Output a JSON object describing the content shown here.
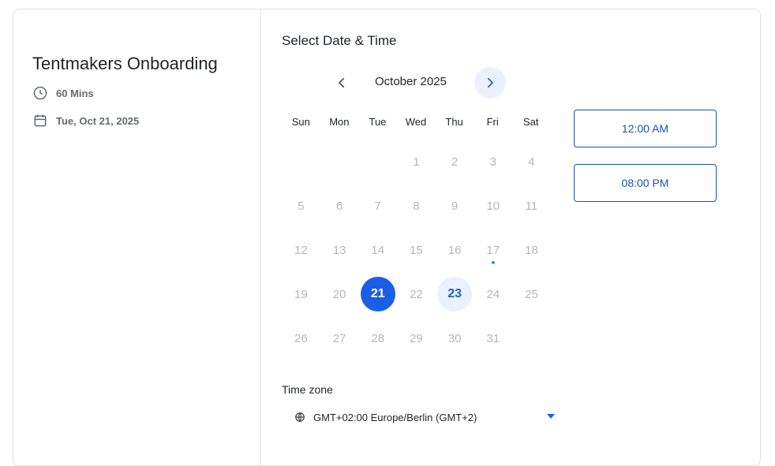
{
  "event": {
    "title": "Tentmakers Onboarding",
    "duration": "60 Mins",
    "date": "Tue, Oct 21, 2025"
  },
  "picker": {
    "heading": "Select Date & Time",
    "month_label": "October 2025",
    "weekdays": [
      "Sun",
      "Mon",
      "Tue",
      "Wed",
      "Thu",
      "Fri",
      "Sat"
    ],
    "leading_blanks": 3,
    "days": [
      {
        "n": "1"
      },
      {
        "n": "2"
      },
      {
        "n": "3"
      },
      {
        "n": "4"
      },
      {
        "n": "5"
      },
      {
        "n": "6"
      },
      {
        "n": "7"
      },
      {
        "n": "8"
      },
      {
        "n": "9"
      },
      {
        "n": "10"
      },
      {
        "n": "11"
      },
      {
        "n": "12"
      },
      {
        "n": "13"
      },
      {
        "n": "14"
      },
      {
        "n": "15"
      },
      {
        "n": "16"
      },
      {
        "n": "17",
        "today": true
      },
      {
        "n": "18"
      },
      {
        "n": "19"
      },
      {
        "n": "20"
      },
      {
        "n": "21",
        "state": "selected"
      },
      {
        "n": "22"
      },
      {
        "n": "23",
        "state": "available"
      },
      {
        "n": "24"
      },
      {
        "n": "25"
      },
      {
        "n": "26"
      },
      {
        "n": "27"
      },
      {
        "n": "28"
      },
      {
        "n": "29"
      },
      {
        "n": "30"
      },
      {
        "n": "31"
      }
    ],
    "time_slots": [
      "12:00 AM",
      "08:00 PM"
    ]
  },
  "timezone": {
    "label": "Time zone",
    "value": "GMT+02:00 Europe/Berlin (GMT+2)"
  },
  "icons": {
    "duration": "clock-icon",
    "date": "calendar-icon",
    "prev": "chevron-left-icon",
    "next": "chevron-right-icon",
    "timezone": "globe-icon",
    "dropdown": "caret-down-icon"
  },
  "colors": {
    "accent": "#1a5ee8",
    "accent_light": "#ebf1fc",
    "slot_border": "#1a4fc0",
    "muted_day": "#b3b6ba"
  }
}
